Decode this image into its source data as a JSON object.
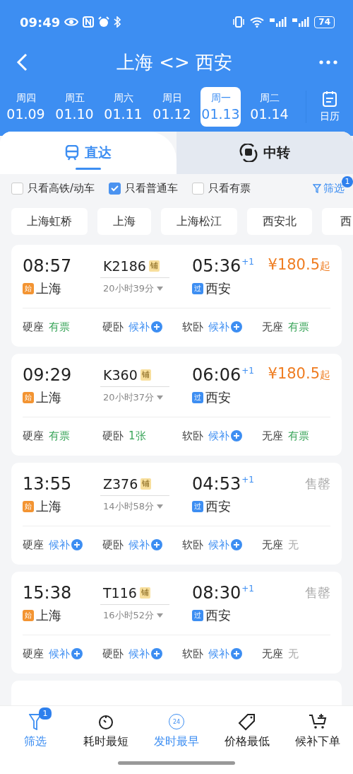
{
  "status_bar": {
    "time": "09:49",
    "battery": "74"
  },
  "header": {
    "title": "上海 <> 西安"
  },
  "dates": [
    {
      "weekday": "周四",
      "date": "01.09",
      "selected": false
    },
    {
      "weekday": "周五",
      "date": "01.10",
      "selected": false
    },
    {
      "weekday": "周六",
      "date": "01.11",
      "selected": false
    },
    {
      "weekday": "周日",
      "date": "01.12",
      "selected": false
    },
    {
      "weekday": "周一",
      "date": "01.13",
      "selected": true
    },
    {
      "weekday": "周二",
      "date": "01.14",
      "selected": false
    }
  ],
  "calendar_label": "日历",
  "tabs": [
    {
      "label": "直达",
      "selected": true
    },
    {
      "label": "中转",
      "selected": false
    }
  ],
  "filters": [
    {
      "label": "只看高铁/动车",
      "checked": false
    },
    {
      "label": "只看普通车",
      "checked": true
    },
    {
      "label": "只看有票",
      "checked": false
    }
  ],
  "filter_button": {
    "label": "筛选",
    "badge": "1"
  },
  "stations": [
    "上海虹桥",
    "上海",
    "上海松江",
    "西安北",
    "西"
  ],
  "trains": [
    {
      "depart": "08:57",
      "train": "K2186",
      "berth_tag": "铺",
      "arrive": "05:36",
      "day_offset": "+1",
      "origin_tag": "始",
      "from": "上海",
      "duration": "20小时39分",
      "dest_tag": "过",
      "to": "西安",
      "fare": {
        "kind": "price",
        "amount": "¥180.5",
        "suffix": "起"
      },
      "seats": [
        {
          "name": "硬座",
          "status": "有票",
          "kind": "available"
        },
        {
          "name": "硬卧",
          "status": "候补",
          "kind": "waitlist"
        },
        {
          "name": "软卧",
          "status": "候补",
          "kind": "waitlist"
        },
        {
          "name": "无座",
          "status": "有票",
          "kind": "available"
        }
      ]
    },
    {
      "depart": "09:29",
      "train": "K360",
      "berth_tag": "铺",
      "arrive": "06:06",
      "day_offset": "+1",
      "origin_tag": "始",
      "from": "上海",
      "duration": "20小时37分",
      "dest_tag": "过",
      "to": "西安",
      "fare": {
        "kind": "price",
        "amount": "¥180.5",
        "suffix": "起"
      },
      "seats": [
        {
          "name": "硬座",
          "status": "有票",
          "kind": "available"
        },
        {
          "name": "硬卧",
          "status": "1张",
          "kind": "available"
        },
        {
          "name": "软卧",
          "status": "候补",
          "kind": "waitlist"
        },
        {
          "name": "无座",
          "status": "有票",
          "kind": "available"
        }
      ]
    },
    {
      "depart": "13:55",
      "train": "Z376",
      "berth_tag": "铺",
      "arrive": "04:53",
      "day_offset": "+1",
      "origin_tag": "始",
      "from": "上海",
      "duration": "14小时58分",
      "dest_tag": "过",
      "to": "西安",
      "fare": {
        "kind": "soldout",
        "text": "售罄"
      },
      "seats": [
        {
          "name": "硬座",
          "status": "候补",
          "kind": "waitlist"
        },
        {
          "name": "硬卧",
          "status": "候补",
          "kind": "waitlist"
        },
        {
          "name": "软卧",
          "status": "候补",
          "kind": "waitlist"
        },
        {
          "name": "无座",
          "status": "无",
          "kind": "none"
        }
      ]
    },
    {
      "depart": "15:38",
      "train": "T116",
      "berth_tag": "铺",
      "arrive": "08:30",
      "day_offset": "+1",
      "origin_tag": "始",
      "from": "上海",
      "duration": "16小时52分",
      "dest_tag": "过",
      "to": "西安",
      "fare": {
        "kind": "soldout",
        "text": "售罄"
      },
      "seats": [
        {
          "name": "硬座",
          "status": "候补",
          "kind": "waitlist"
        },
        {
          "name": "硬卧",
          "status": "候补",
          "kind": "waitlist"
        },
        {
          "name": "软卧",
          "status": "候补",
          "kind": "waitlist"
        },
        {
          "name": "无座",
          "status": "无",
          "kind": "none"
        }
      ]
    }
  ],
  "bottom_bar": [
    {
      "label": "筛选",
      "selected": true,
      "badge": "1"
    },
    {
      "label": "耗时最短",
      "selected": false
    },
    {
      "label": "发时最早",
      "selected": true,
      "icon_text": "24"
    },
    {
      "label": "价格最低",
      "selected": false
    },
    {
      "label": "候补下单",
      "selected": false
    }
  ]
}
